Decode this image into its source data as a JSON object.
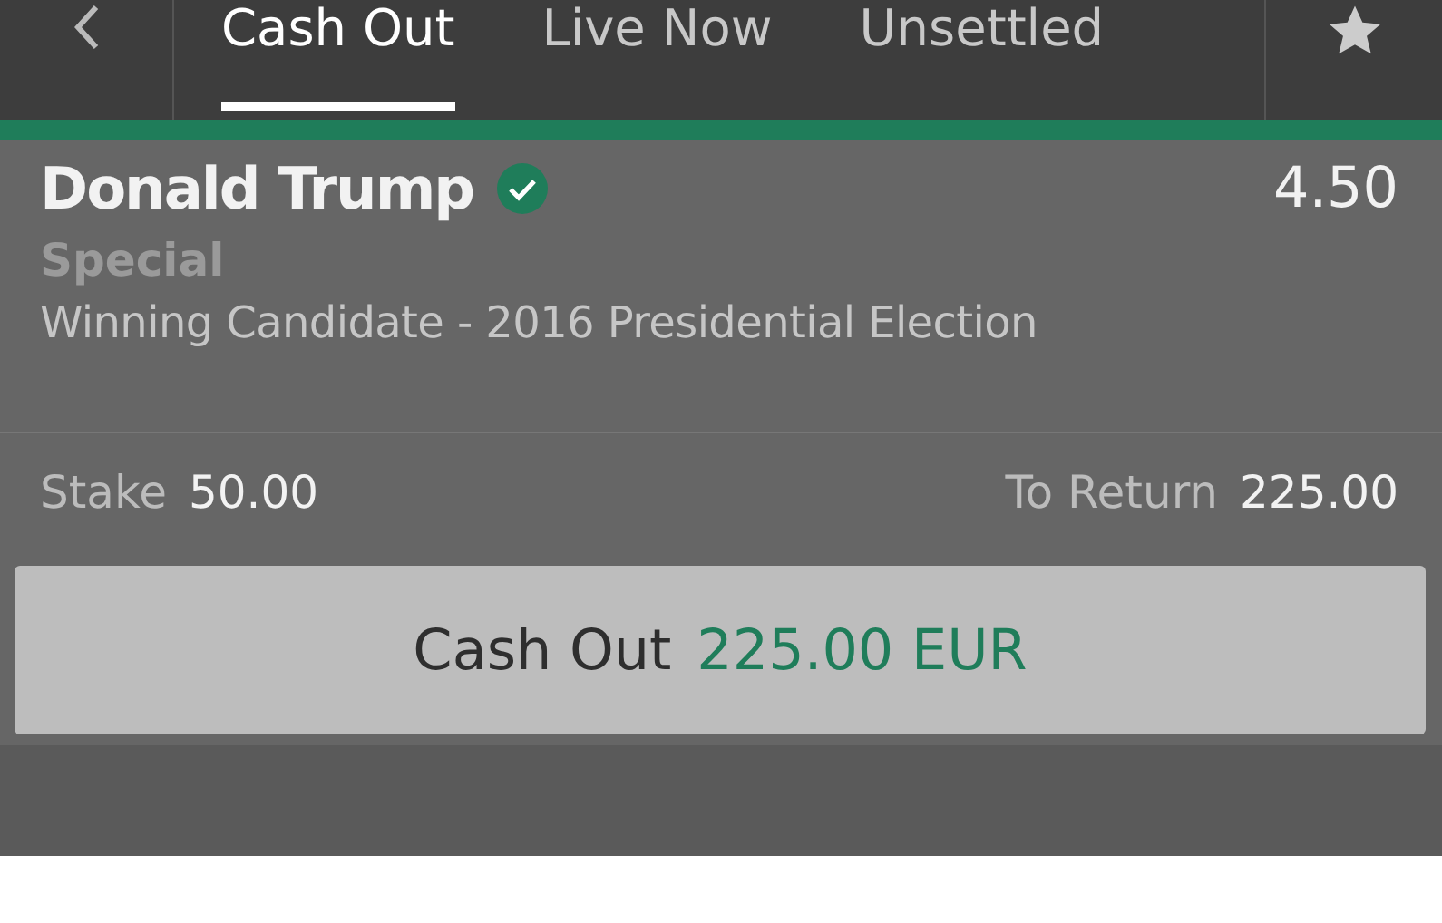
{
  "tabs": [
    {
      "label": "Cash Out",
      "selected": true
    },
    {
      "label": "Live Now",
      "selected": false
    },
    {
      "label": "Unsettled",
      "selected": false
    }
  ],
  "bet": {
    "selection": "Donald Trump",
    "verified": true,
    "odds": "4.50",
    "market_type": "Special",
    "market": "Winning Candidate - 2016 Presidential Election",
    "stake_label": "Stake",
    "stake": "50.00",
    "return_label": "To Return",
    "return": "225.00",
    "cash_out_label": "Cash Out",
    "cash_out_amount": "225.00 EUR"
  }
}
